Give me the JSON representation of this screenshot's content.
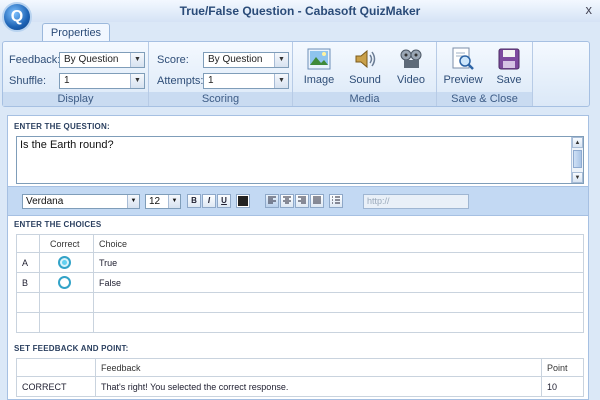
{
  "window": {
    "title": "True/False Question - Cabasoft QuizMaker",
    "logo": "Q",
    "close": "x"
  },
  "ribbon": {
    "tab": "Properties",
    "display": {
      "label": "Display",
      "feedback_label": "Feedback:",
      "feedback_value": "By Question",
      "shuffle_label": "Shuffle:",
      "shuffle_value": "1"
    },
    "scoring": {
      "label": "Scoring",
      "score_label": "Score:",
      "score_value": "By Question",
      "attempts_label": "Attempts:",
      "attempts_value": "1"
    },
    "media": {
      "label": "Media",
      "image": "Image",
      "sound": "Sound",
      "video": "Video"
    },
    "save_close": {
      "label": "Save & Close",
      "preview": "Preview",
      "save": "Save"
    }
  },
  "question": {
    "heading": "ENTER THE QUESTION:",
    "text": "Is the Earth round?",
    "font": "Verdana",
    "size": "12",
    "format": {
      "bold": "B",
      "italic": "I",
      "underline": "U"
    },
    "url_placeholder": "http://"
  },
  "choices": {
    "heading": "ENTER THE CHOICES",
    "columns": {
      "correct": "Correct",
      "choice": "Choice"
    },
    "rows": [
      {
        "key": "A",
        "text": "True",
        "correct": true
      },
      {
        "key": "B",
        "text": "False",
        "correct": false
      }
    ]
  },
  "feedback": {
    "heading": "SET FEEDBACK AND POINT:",
    "columns": {
      "feedback": "Feedback",
      "point": "Point"
    },
    "rows": [
      {
        "type": "CORRECT",
        "text": "That's right!  You selected the correct response.",
        "point": "10"
      }
    ]
  },
  "colors": {
    "accent": "#1d63b5",
    "ribbon_bg": "#dbe8f7",
    "toolbar_bg": "#c3d9f3",
    "radio": "#33a3c8"
  },
  "icons": [
    "image-icon",
    "sound-icon",
    "video-icon",
    "preview-icon",
    "save-icon",
    "color-icon",
    "align-left-icon",
    "align-center-icon",
    "align-right-icon",
    "justify-icon",
    "list-icon"
  ]
}
